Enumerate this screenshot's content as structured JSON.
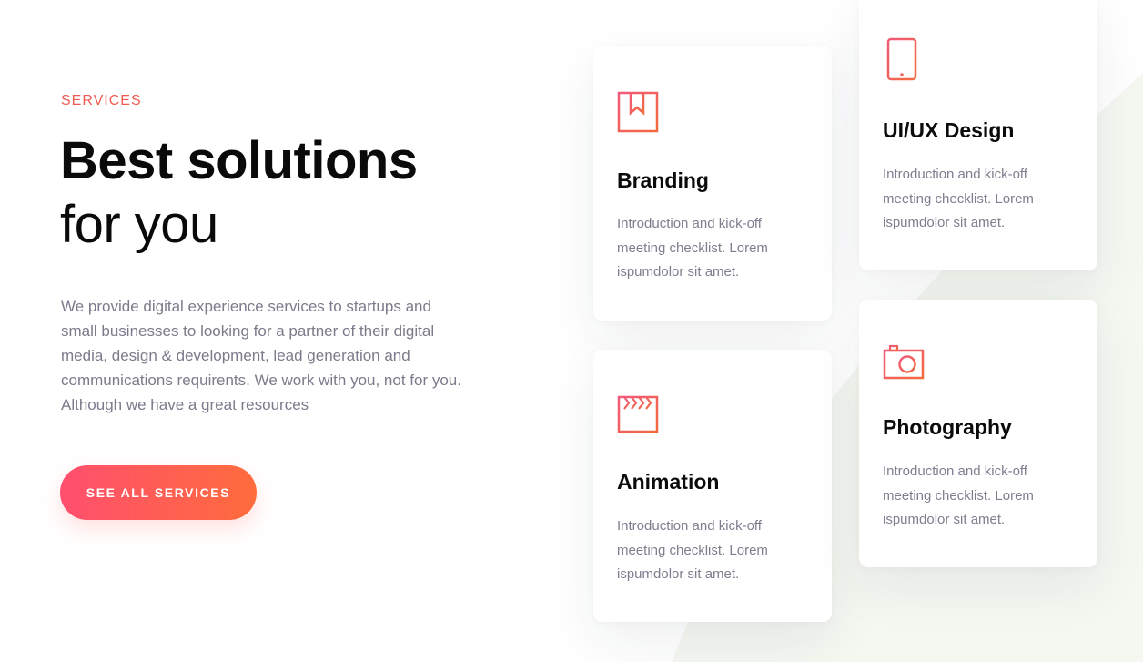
{
  "section": {
    "eyebrow": "SERVICES",
    "title_bold": "Best solutions",
    "title_light": "for you",
    "description": "We provide digital experience services to startups and small businesses to looking for a partner of their digital media, design & development, lead generation and communications requirents. We work with you, not for you. Although we have a great resources",
    "cta_label": "SEE ALL SERVICES"
  },
  "services": [
    {
      "title": "Branding",
      "text": "Introduction and kick-off meeting checklist. Lorem ispumdolor sit amet.",
      "icon": "bookmark-icon"
    },
    {
      "title": "UI/UX Design",
      "text": "Introduction and kick-off meeting checklist. Lorem ispumdolor sit amet.",
      "icon": "mobile-phone-icon"
    },
    {
      "title": "Animation",
      "text": "Introduction and kick-off meeting checklist. Lorem ispumdolor sit amet.",
      "icon": "clapperboard-icon"
    },
    {
      "title": "Photography",
      "text": "Introduction and kick-off meeting checklist. Lorem ispumdolor sit amet.",
      "icon": "camera-icon"
    }
  ],
  "colors": {
    "accent": "#ef5b52",
    "gradient_start": "#ff4f6e",
    "gradient_end": "#ff6c3c",
    "heading": "#0b0b0b",
    "body_text": "#7b7b8b",
    "bg_shape": "#f5f7f1"
  }
}
